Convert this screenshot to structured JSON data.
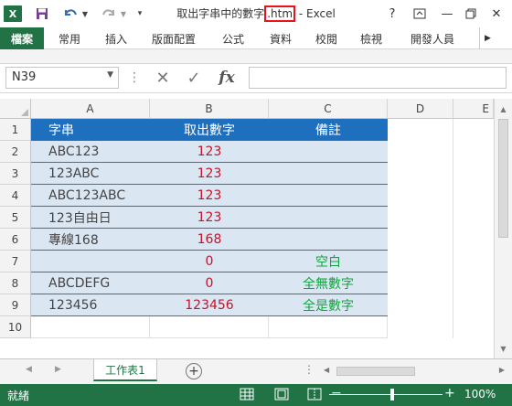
{
  "title": {
    "prefix": "取出字串中的數字",
    "highlight": ".htm",
    "suffix": " - Excel"
  },
  "window_buttons": {
    "help": "?",
    "minimize": "—",
    "close": "✕"
  },
  "ribbon_tabs": [
    "檔案",
    "常用",
    "插入",
    "版面配置",
    "公式",
    "資料",
    "校閱",
    "檢視",
    "開發人員"
  ],
  "name_box": {
    "value": "N39"
  },
  "formula_bar": {
    "fx": "fx",
    "value": ""
  },
  "columns": [
    "A",
    "B",
    "C",
    "D",
    "E"
  ],
  "rows": [
    "1",
    "2",
    "3",
    "4",
    "5",
    "6",
    "7",
    "8",
    "9",
    "10"
  ],
  "table": {
    "header": {
      "a": "字串",
      "b": "取出數字",
      "c": "備註"
    },
    "rows": [
      {
        "a": "ABC123",
        "b": "123",
        "c": ""
      },
      {
        "a": "123ABC",
        "b": "123",
        "c": ""
      },
      {
        "a": "ABC123ABC",
        "b": "123",
        "c": ""
      },
      {
        "a": "123自由日",
        "b": "123",
        "c": ""
      },
      {
        "a": "專線168",
        "b": "168",
        "c": ""
      },
      {
        "a": "",
        "b": "0",
        "c": "空白"
      },
      {
        "a": "ABCDEFG",
        "b": "0",
        "c": "全無數字"
      },
      {
        "a": "123456",
        "b": "123456",
        "c": "全是數字"
      }
    ]
  },
  "sheet_tab": "工作表1",
  "status": {
    "ready": "就緒",
    "zoom": "100%"
  },
  "colors": {
    "excel_green": "#217346",
    "header_blue": "#1f6fbf",
    "band_blue": "#dbe6f3",
    "value_red": "#c0152a",
    "note_green": "#12a63e",
    "highlight_red": "#e8141a"
  },
  "icons": [
    "excel-logo-icon",
    "save-icon",
    "undo-icon",
    "redo-icon",
    "customize-qat-icon",
    "help-icon",
    "ribbon-display-icon",
    "minimize-icon",
    "restore-icon",
    "close-icon",
    "cancel-icon",
    "enter-icon",
    "insert-function-icon",
    "new-sheet-icon",
    "normal-view-icon",
    "page-layout-view-icon",
    "page-break-view-icon"
  ]
}
